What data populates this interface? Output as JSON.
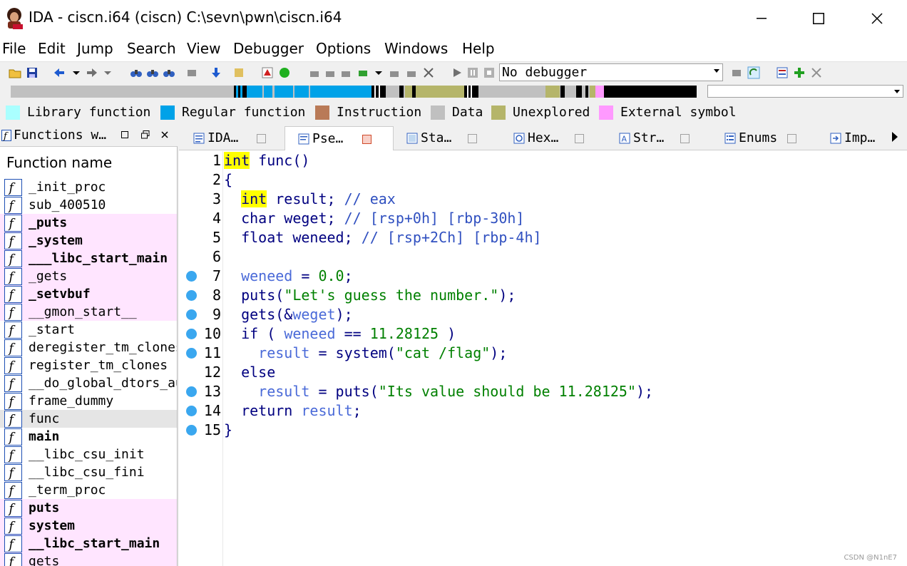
{
  "window": {
    "title": "IDA - ciscn.i64 (ciscn) C:\\sevn\\pwn\\ciscn.i64",
    "minimize": "—",
    "maximize": "☐",
    "close": "✕"
  },
  "menu": [
    "File",
    "Edit",
    "Jump",
    "Search",
    "View",
    "Debugger",
    "Options",
    "Windows",
    "Help"
  ],
  "toolbar": {
    "debugger_select": "No debugger"
  },
  "legend": [
    {
      "label": "Library function",
      "color": "#aaffff"
    },
    {
      "label": "Regular function",
      "color": "#00a2e8"
    },
    {
      "label": "Instruction",
      "color": "#b97a57"
    },
    {
      "label": "Data",
      "color": "#c0c0c0"
    },
    {
      "label": "Unexplored",
      "color": "#b5b56a"
    },
    {
      "label": "External symbol",
      "color": "#ff99ff"
    }
  ],
  "functions_panel": {
    "title": "Functions w…",
    "column_header": "Function name",
    "items": [
      {
        "name": "_init_proc",
        "bold": false,
        "pink": false
      },
      {
        "name": "sub_400510",
        "bold": false,
        "pink": false
      },
      {
        "name": "_puts",
        "bold": true,
        "pink": true
      },
      {
        "name": "_system",
        "bold": true,
        "pink": true
      },
      {
        "name": "___libc_start_main",
        "bold": true,
        "pink": true
      },
      {
        "name": "_gets",
        "bold": false,
        "pink": true
      },
      {
        "name": "_setvbuf",
        "bold": true,
        "pink": true
      },
      {
        "name": "__gmon_start__",
        "bold": false,
        "pink": true
      },
      {
        "name": "_start",
        "bold": false,
        "pink": false
      },
      {
        "name": "deregister_tm_clones",
        "bold": false,
        "pink": false
      },
      {
        "name": "register_tm_clones",
        "bold": false,
        "pink": false
      },
      {
        "name": "__do_global_dtors_aux",
        "bold": false,
        "pink": false
      },
      {
        "name": "frame_dummy",
        "bold": false,
        "pink": false
      },
      {
        "name": "func",
        "bold": false,
        "pink": false,
        "selected": true
      },
      {
        "name": "main",
        "bold": true,
        "pink": false
      },
      {
        "name": "__libc_csu_init",
        "bold": false,
        "pink": false
      },
      {
        "name": "__libc_csu_fini",
        "bold": false,
        "pink": false
      },
      {
        "name": "_term_proc",
        "bold": false,
        "pink": false
      },
      {
        "name": "puts",
        "bold": true,
        "pink": true
      },
      {
        "name": "system",
        "bold": true,
        "pink": true
      },
      {
        "name": "__libc_start_main",
        "bold": true,
        "pink": true
      },
      {
        "name": "gets",
        "bold": false,
        "pink": true
      }
    ]
  },
  "tabs": [
    {
      "label": "IDA…",
      "active": false
    },
    {
      "label": "Pse…",
      "active": true
    },
    {
      "label": "Sta…",
      "active": false
    },
    {
      "label": "Hex…",
      "active": false
    },
    {
      "label": "Str…",
      "active": false
    },
    {
      "label": "Enums",
      "active": false
    },
    {
      "label": "Imp…",
      "active": false
    }
  ],
  "code": {
    "line_numbers": [
      "1",
      "2",
      "3",
      "4",
      "5",
      "6",
      "7",
      "8",
      "9",
      "10",
      "11",
      "12",
      "13",
      "14",
      "15"
    ],
    "l1_kw": "int",
    "l1_rest": " func()",
    "l2": "{",
    "l3_kw": "int",
    "l3_var": " result; ",
    "l3_cmt": "// eax",
    "l4_type": "char",
    "l4_var": " weget; ",
    "l4_cmt": "// [rsp+0h] [rbp-30h]",
    "l5_type": "float",
    "l5_var": " weneed; ",
    "l5_cmt": "// [rsp+2Ch] [rbp-4h]",
    "l7_var": "weneed",
    "l7_op": " = ",
    "l7_num": "0.0",
    "l7_end": ";",
    "l8_fn": "puts(",
    "l8_str": "\"Let's guess the number.\"",
    "l8_end": ");",
    "l9_fn": "gets(&",
    "l9_var": "weget",
    "l9_end": ");",
    "l10_kw": "if",
    "l10_p": " ( ",
    "l10_var": "weneed",
    "l10_op": " == ",
    "l10_num": "11.28125",
    "l10_end": " )",
    "l11_var": "result",
    "l11_op": " = system(",
    "l11_str": "\"cat /flag\"",
    "l11_end": ");",
    "l12_kw": "else",
    "l13_var": "result",
    "l13_op": " = puts(",
    "l13_str": "\"Its value should be 11.28125\"",
    "l13_end": ");",
    "l14_kw": "return",
    "l14_var": " result",
    "l14_end": ";",
    "l15": "}"
  },
  "watermark": "CSDN @N1nE7"
}
